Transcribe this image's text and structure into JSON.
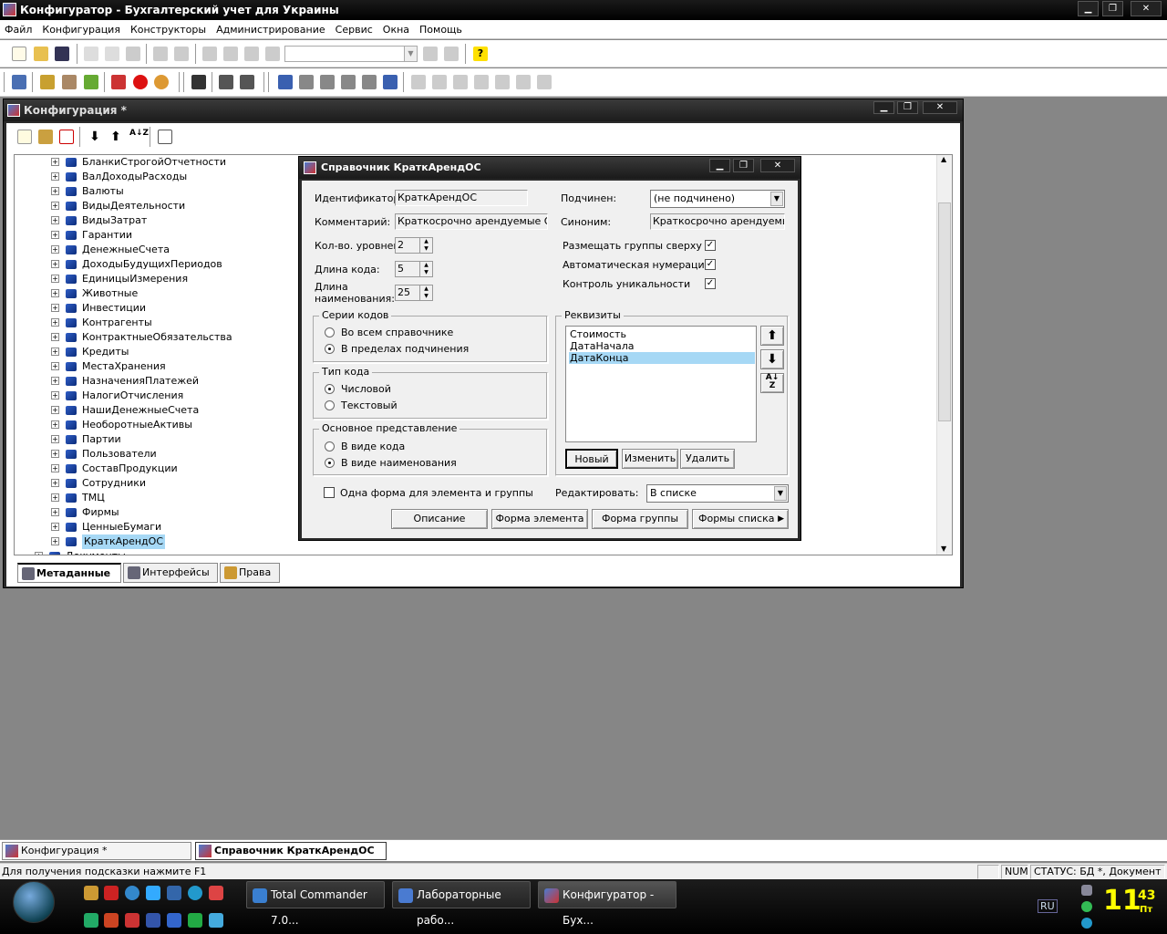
{
  "app": {
    "title": "Конфигуратор - Бухгалтерский учет для Украины",
    "min": "▁",
    "max": "❐",
    "close": "✕"
  },
  "menu": [
    "Файл",
    "Конфигурация",
    "Конструкторы",
    "Администрирование",
    "Сервис",
    "Окна",
    "Помощь"
  ],
  "config_window": {
    "title": "Конфигурация *",
    "tree_items": [
      "БланкиСтрогойОтчетности",
      "ВалДоходыРасходы",
      "Валюты",
      "ВидыДеятельности",
      "ВидыЗатрат",
      "Гарантии",
      "ДенежныеСчета",
      "ДоходыБудущихПериодов",
      "ЕдиницыИзмерения",
      "Животные",
      "Инвестиции",
      "Контрагенты",
      "КонтрактныеОбязательства",
      "Кредиты",
      "МестаХранения",
      "НазначенияПлатежей",
      "НалогиОтчисления",
      "НашиДенежныеСчета",
      "НеоборотныеАктивы",
      "Партии",
      "Пользователи",
      "СоставПродукции",
      "Сотрудники",
      "ТМЦ",
      "Фирмы",
      "ЦенныеБумаги",
      "КраткАрендОС"
    ],
    "tree_documents": "Документы",
    "tabs": [
      "Метаданные",
      "Интерфейсы",
      "Права"
    ]
  },
  "dialog": {
    "title": "Справочник КраткАрендОС",
    "identifier_label": "Идентификатор:",
    "identifier_value": "КраткАрендОС",
    "comment_label": "Комментарий:",
    "comment_value": "Краткосрочно арендуемые ОС",
    "levels_label": "Кол-во. уровней:",
    "levels_value": "2",
    "code_len_label": "Длина кода:",
    "code_len_value": "5",
    "name_len_label_1": "Длина",
    "name_len_label_2": "наименования:",
    "name_len_value": "25",
    "subordinate_label": "Подчинен:",
    "subordinate_value": "(не подчинено)",
    "synonym_label": "Синоним:",
    "synonym_value": "Краткосрочно арендуемые",
    "place_groups_top": "Размещать группы сверху",
    "auto_numbering": "Автоматическая нумерация",
    "uniqueness_check": "Контроль уникальности",
    "code_series_title": "Серии кодов",
    "code_series_opt1": "Во всем справочнике",
    "code_series_opt2": "В пределах подчинения",
    "code_type_title": "Тип кода",
    "code_type_opt1": "Числовой",
    "code_type_opt2": "Текстовый",
    "main_repr_title": "Основное представление",
    "main_repr_opt1": "В виде кода",
    "main_repr_opt2": "В виде наименования",
    "attrs_title": "Реквизиты",
    "attrs": [
      "Стоимость",
      "ДатаНачала",
      "ДатаКонца"
    ],
    "btn_new": "Новый",
    "btn_edit": "Изменить",
    "btn_delete": "Удалить",
    "one_form_label": "Одна форма для элемента и группы",
    "edit_label": "Редактировать:",
    "edit_value": "В списке",
    "btn_description": "Описание",
    "btn_element_form": "Форма элемента",
    "btn_group_form": "Форма группы",
    "btn_list_forms": "Формы списка"
  },
  "mdi_tasks": [
    "Конфигурация *",
    "Справочник КраткАрендОС"
  ],
  "status": {
    "hint": "Для получения подсказки нажмите F1",
    "num": "NUM",
    "state": "СТАТУС: БД *, Документ *"
  },
  "taskbar": {
    "buttons": [
      "Total Commander 7.0...",
      "Лабораторные рабо...",
      "Конфигуратор - Бух..."
    ],
    "lang": "RU",
    "clock_hour": "11",
    "clock_min": "43",
    "clock_day": "Пт"
  }
}
